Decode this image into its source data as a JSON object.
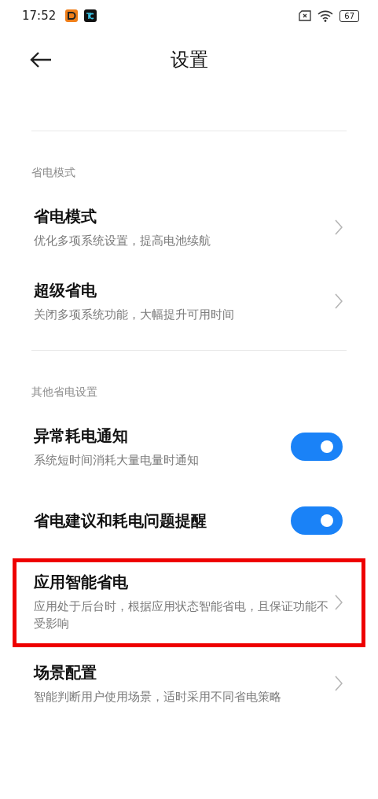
{
  "status_bar": {
    "time": "17:52",
    "battery": "67"
  },
  "header": {
    "title": "设置"
  },
  "sections": [
    {
      "title": "省电模式",
      "items": [
        {
          "kind": "link",
          "title": "省电模式",
          "description": "优化多项系统设置，提高电池续航",
          "highlighted": false
        },
        {
          "kind": "link",
          "title": "超级省电",
          "description": "关闭多项系统功能，大幅提升可用时间",
          "highlighted": false
        }
      ]
    },
    {
      "title": "其他省电设置",
      "items": [
        {
          "kind": "toggle",
          "title": "异常耗电通知",
          "description": "系统短时间消耗大量电量时通知",
          "on": true,
          "highlighted": false
        },
        {
          "kind": "toggle",
          "title": "省电建议和耗电问题提醒",
          "on": true,
          "highlighted": false
        },
        {
          "kind": "link",
          "title": "应用智能省电",
          "description": "应用处于后台时，根据应用状态智能省电，且保证功能不受影响",
          "highlighted": true
        },
        {
          "kind": "link",
          "title": "场景配置",
          "description": "智能判断用户使用场景，适时采用不同省电策略",
          "highlighted": false
        }
      ]
    }
  ]
}
